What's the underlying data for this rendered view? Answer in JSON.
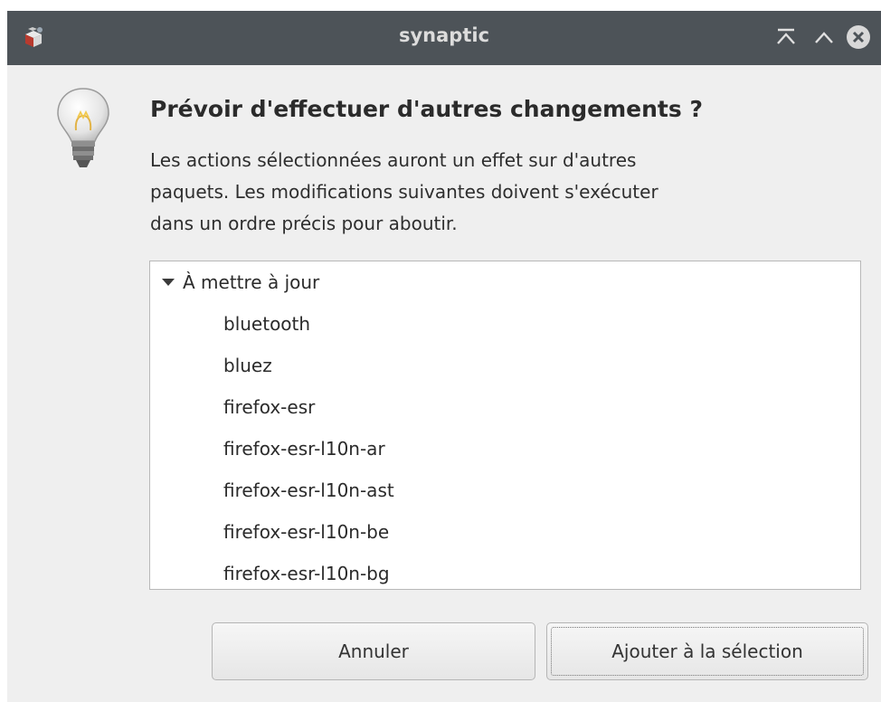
{
  "titlebar": {
    "title": "synaptic",
    "icons": {
      "app": "synaptic-package-icon",
      "keep_above": "keep-above-icon",
      "maximize": "maximize-icon",
      "close": "close-icon"
    }
  },
  "dialog": {
    "icon": "lightbulb-icon",
    "heading": "Prévoir d'effectuer d'autres changements ?",
    "message_lines": [
      "Les actions sélectionnées auront un effet sur d'autres",
      "paquets. Les modifications suivantes doivent s'exécuter",
      "dans un ordre précis pour aboutir."
    ]
  },
  "changes": {
    "group_label": "À mettre à jour",
    "expanded": true,
    "packages": [
      "bluetooth",
      "bluez",
      "firefox-esr",
      "firefox-esr-l10n-ar",
      "firefox-esr-l10n-ast",
      "firefox-esr-l10n-be",
      "firefox-esr-l10n-bg"
    ]
  },
  "buttons": {
    "cancel_label": "Annuler",
    "add_label": "Ajouter à la sélection"
  },
  "colors": {
    "titlebar_bg": "#4d5358",
    "window_bg": "#efefef",
    "close_button": "#d8d8d8"
  }
}
